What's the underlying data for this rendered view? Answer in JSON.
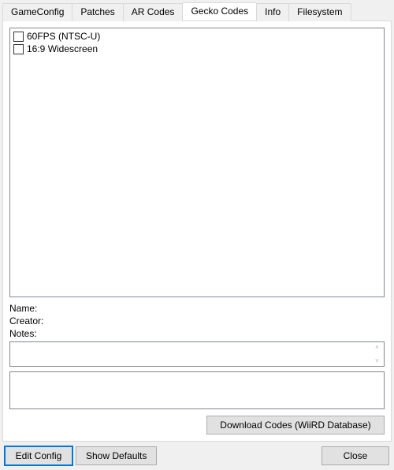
{
  "tabs": {
    "game_config": "GameConfig",
    "patches": "Patches",
    "ar_codes": "AR Codes",
    "gecko_codes": "Gecko Codes",
    "info": "Info",
    "filesystem": "Filesystem"
  },
  "codes": [
    {
      "label": "60FPS (NTSC-U)",
      "checked": false
    },
    {
      "label": "16:9 Widescreen",
      "checked": false
    }
  ],
  "labels": {
    "name": "Name:",
    "creator": "Creator:",
    "notes": "Notes:"
  },
  "values": {
    "name": "",
    "creator": "",
    "notes": ""
  },
  "buttons": {
    "download": "Download Codes (WiiRD Database)",
    "edit_config": "Edit Config",
    "show_defaults": "Show Defaults",
    "close": "Close"
  }
}
